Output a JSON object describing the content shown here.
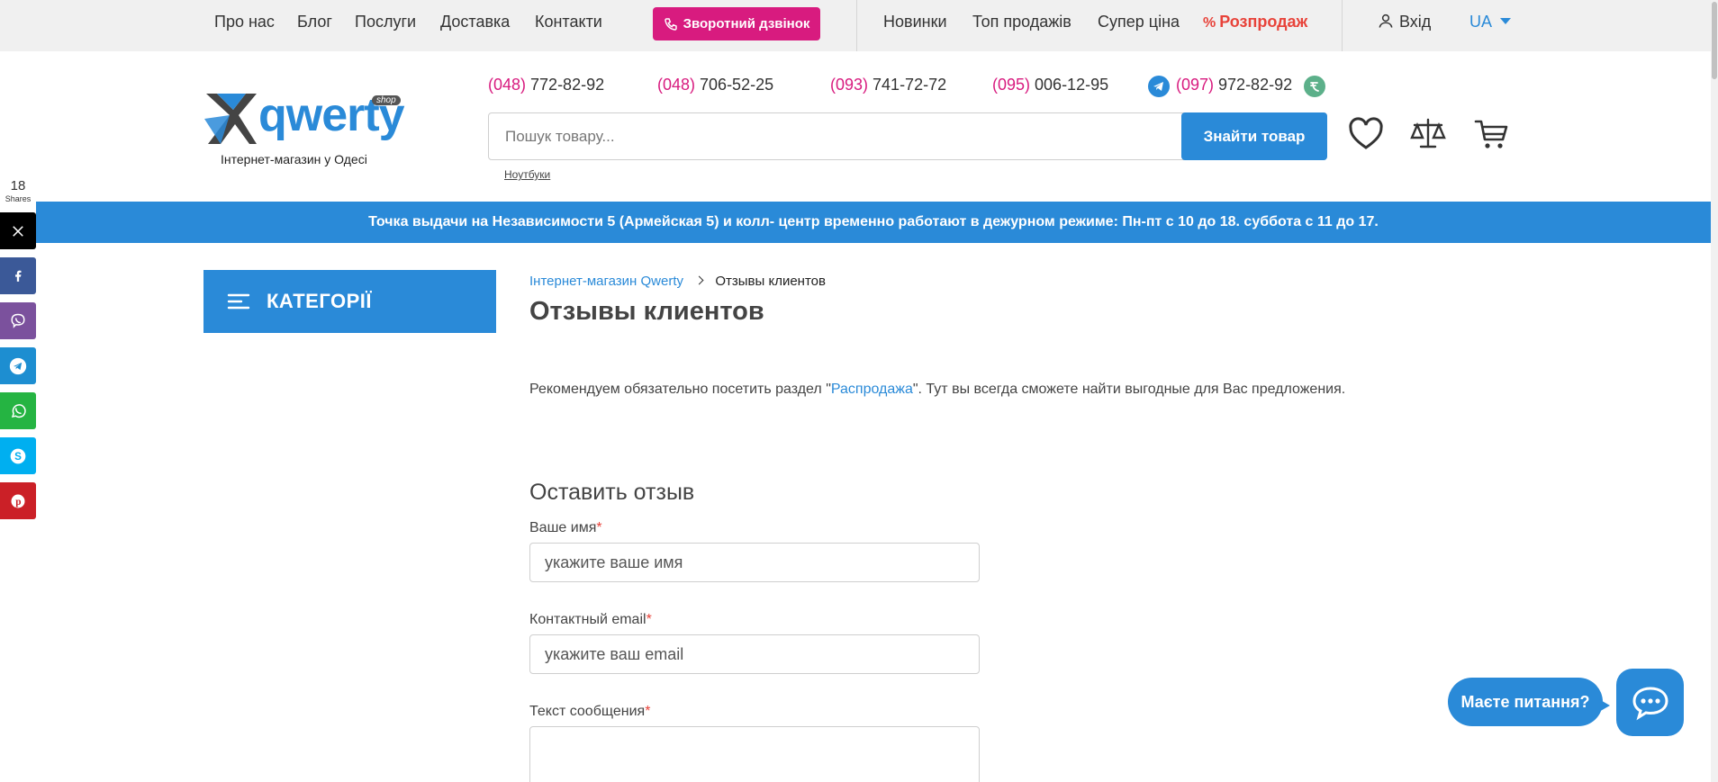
{
  "nav": {
    "about": "Про нас",
    "blog": "Блог",
    "services": "Послуги",
    "delivery": "Доставка",
    "contacts": "Контакти",
    "callback": "Зворотний дзвінок",
    "new": "Новинки",
    "top_sales": "Топ продажів",
    "super_price": "Супер ціна",
    "sale": "Розпродаж",
    "login": "Вхід",
    "lang": "UA"
  },
  "logo": {
    "text": "qwerty",
    "badge": "shop",
    "subtitle": "Інтернет-магазин у Одесі"
  },
  "phones": [
    {
      "code": "(048)",
      "number": " 772-82-92"
    },
    {
      "code": "(048)",
      "number": " 706-52-25"
    },
    {
      "code": "(093)",
      "number": " 741-72-72"
    },
    {
      "code": "(095)",
      "number": " 006-12-95"
    },
    {
      "code": "(097)",
      "number": " 972-82-92"
    }
  ],
  "search": {
    "placeholder": "Пошук товару...",
    "button": "Знайти товар",
    "hint": "Ноутбуки"
  },
  "notice": "Точка выдачи на Независимости 5 (Армейская 5) и колл- центр временно работают в дежурном режиме: Пн-пт с 10 до 18. суббота с 11 до 17.",
  "share": {
    "count": "18",
    "label": "Shares",
    "networks": [
      {
        "name": "x",
        "color": "#000000"
      },
      {
        "name": "facebook",
        "color": "#3b5998"
      },
      {
        "name": "viber",
        "color": "#7b519d"
      },
      {
        "name": "telegram",
        "color": "#1d8ed1"
      },
      {
        "name": "whatsapp",
        "color": "#25b442"
      },
      {
        "name": "skype",
        "color": "#00aff0"
      },
      {
        "name": "pinterest",
        "color": "#cb2027"
      }
    ]
  },
  "categories": {
    "label": "КАТЕГОРІЇ"
  },
  "breadcrumb": {
    "home": "Інтернет-магазин Qwerty",
    "separator": ">",
    "current": "Отзывы клиентов"
  },
  "page": {
    "title": "Отзывы клиентов",
    "recommend_prefix": "Рекомендуем обязательно посетить раздел \"",
    "recommend_link": "Распродажа",
    "recommend_suffix": "\". Тут вы всегда сможете найти выгодные для Вас предложения."
  },
  "form": {
    "title": "Оставить отзыв",
    "name_label": "Ваше имя",
    "name_placeholder": "укажите ваше имя",
    "email_label": "Контактный email",
    "email_placeholder": "укажите ваш email",
    "message_label": "Текст сообщения",
    "required_mark": "*"
  },
  "chat": {
    "bubble": "Маєте питання?"
  },
  "colors": {
    "accent": "#2a8ad8",
    "brand_pink": "#d81b7f",
    "sale_red": "#e8433a"
  }
}
